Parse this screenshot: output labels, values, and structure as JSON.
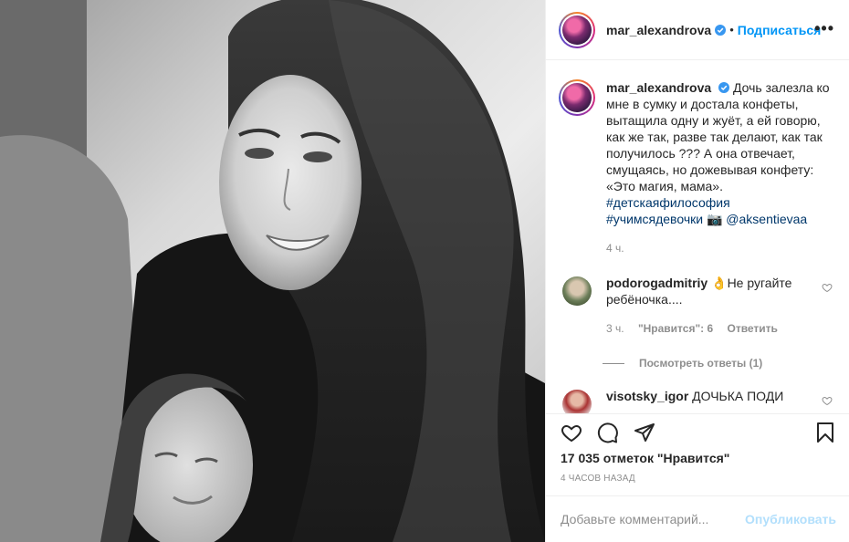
{
  "post": {
    "username": "mar_alexandrova",
    "follow_label": "Подписаться",
    "more_label": "•••",
    "caption": "Дочь залезла ко мне в сумку и достала конфеты, вытащила одну и жуёт, а ей говорю, как же так, разве так делают, как так получилось ??? А она отвечает, смущаясь, но дожевывая конфету: «Это магия, мама».",
    "hashtag1": "#детскаяфилософия",
    "hashtag2": "#учимсядевочки",
    "camera_emoji": "📷",
    "mention": "@aksentievaa",
    "time": "4 ч."
  },
  "comments": [
    {
      "username": "podorogadmitriy",
      "emoji": "👌",
      "text": "Не ругайте ребёночка....",
      "time": "3 ч.",
      "likes": "\"Нравится\": 6",
      "reply": "Ответить",
      "view_replies": "Посмотреть ответы (1)"
    },
    {
      "username": "visotsky_igor",
      "text": "ДОЧЬКА ПОДИ"
    }
  ],
  "stats": {
    "likes": "17 035 отметок \"Нравится\"",
    "posted": "4 ЧАСОВ НАЗАД"
  },
  "composer": {
    "placeholder": "Добавьте комментарий...",
    "publish": "Опубликовать"
  },
  "icons": [
    "heart-icon",
    "comment-icon",
    "share-icon",
    "bookmark-icon",
    "verified-icon",
    "more-icon"
  ],
  "colors": {
    "accent": "#0095f6",
    "link": "#00376b",
    "muted": "#8e8e8e",
    "publish_disabled": "#b2dffc"
  }
}
